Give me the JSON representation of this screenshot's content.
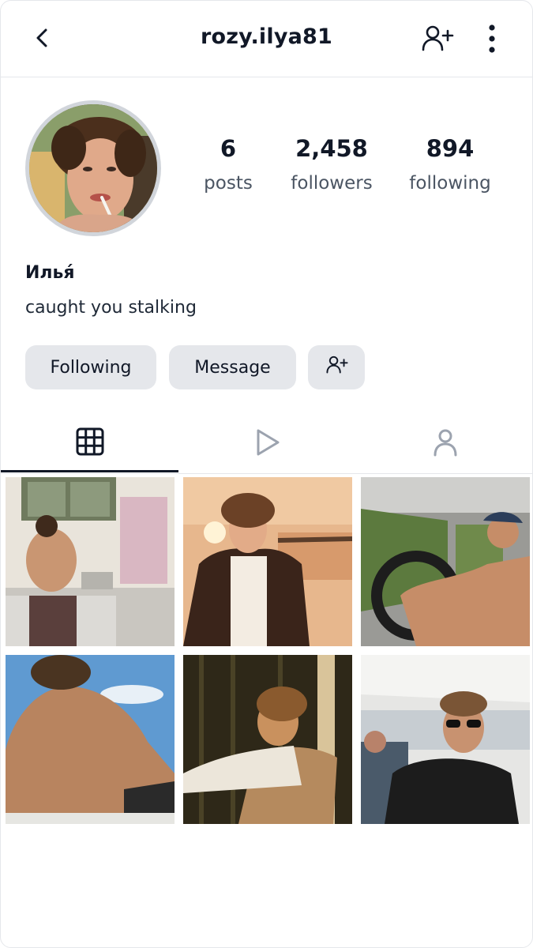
{
  "header": {
    "username": "rozy.ilya81",
    "back_icon": "chevron-left-icon",
    "add_user_icon": "person-plus-icon",
    "more_icon": "more-vertical-icon"
  },
  "profile": {
    "display_name": "Илья́",
    "bio": "caught you stalking",
    "stats": {
      "posts": {
        "value": "6",
        "label": "posts"
      },
      "followers": {
        "value": "2,458",
        "label": "followers"
      },
      "following": {
        "value": "894",
        "label": "following"
      }
    }
  },
  "actions": {
    "following_label": "Following",
    "message_label": "Message",
    "suggest_icon": "person-plus-icon"
  },
  "tabs": [
    {
      "icon": "grid-icon",
      "active": true
    },
    {
      "icon": "play-icon",
      "active": false
    },
    {
      "icon": "person-icon",
      "active": false
    }
  ],
  "posts": [
    {
      "subject": "kitchen"
    },
    {
      "subject": "jacket-selfie"
    },
    {
      "subject": "driving"
    },
    {
      "subject": "beach-back"
    },
    {
      "subject": "chair-evening"
    },
    {
      "subject": "sunglasses-cafe"
    }
  ],
  "colors": {
    "text": "#111827",
    "muted": "#4b5563",
    "button_bg": "#e5e7eb",
    "divider": "#e5e7eb"
  }
}
